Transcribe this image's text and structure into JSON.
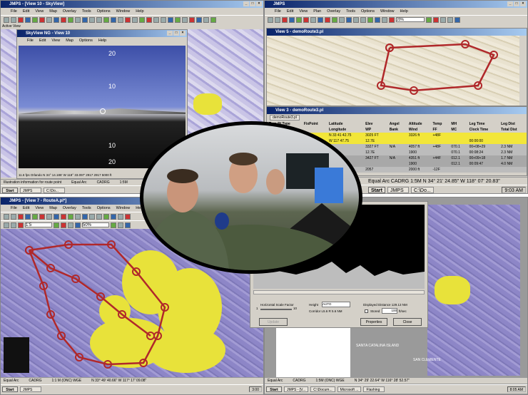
{
  "top_left": {
    "title": "JMPS - [View 10 - SkyView]",
    "menu": [
      "File",
      "Edit",
      "View",
      "Map",
      "Overlay",
      "Tools",
      "Options",
      "Window",
      "Help"
    ],
    "active_view_label": "Active View",
    "skyview": {
      "title": "SkyView NG - View 10",
      "menu": [
        "File",
        "Edit",
        "View",
        "Map",
        "Options",
        "Help"
      ],
      "pitch_labels": [
        "20",
        "10",
        "10",
        "20"
      ],
      "status": "11.6 fps  Orlando  N 34° 14.186'  W 118° 33.097'  2917  2917  5000 ft"
    },
    "status": "Illustration information for route point",
    "status_right": [
      "Equal Arc",
      "CADRG",
      "1:5M"
    ],
    "taskbar": {
      "start": "Start",
      "tasks": [
        "JMPS",
        "C:\\Do..."
      ]
    }
  },
  "top_right": {
    "title": "JMPS",
    "menu": [
      "File",
      "Edit",
      "View",
      "Plan",
      "Overlay",
      "Tools",
      "Options",
      "Window",
      "Help"
    ],
    "zoom_value": "20%",
    "map_view_title": "View 5 - demoRoute3.pl",
    "table_view_title": "View 3 - demoRoute3.pl",
    "table_tab": "demoRoute3.pl",
    "table_headers": [
      [
        "Turn Pt Type",
        "FixPoint",
        "Latitude",
        "Elev",
        "Angel",
        "Altitude",
        "Temp",
        "MH",
        "Leg Time",
        "Leg Dist"
      ],
      [
        "",
        "",
        "Longitude",
        "WP",
        "Bank",
        "Wind",
        "FF",
        "MC",
        "Clock Time",
        "Total Dist"
      ]
    ],
    "table_rows": [
      [
        "",
        "",
        "N 33 41 42.75",
        "3025 FT",
        "",
        "3326 ft",
        "+48F",
        "",
        "",
        ""
      ],
      [
        "",
        "",
        "W 117 47.75",
        "12.7E",
        "",
        "",
        "",
        "",
        "00:00:00",
        ""
      ],
      [
        "",
        "",
        "",
        "3327 FT",
        "N/A",
        "4057 ft",
        "+48F",
        "070.1",
        "00+08+29",
        "2.3 NM"
      ],
      [
        "",
        "",
        "",
        "12.7E",
        "",
        "1900",
        "",
        "070.1",
        "00:08:24",
        "2.3 NM"
      ],
      [
        "",
        "",
        "",
        "3427 FT",
        "N/A",
        "4351 ft",
        "+44F",
        "012.1",
        "00+09+18",
        "1.7 NM"
      ],
      [
        "",
        "",
        "",
        "",
        "",
        "1900",
        "",
        "012.1",
        "00:09:47",
        "4.0 NM"
      ],
      [
        "",
        "",
        "",
        "2057",
        "",
        "2000 ft",
        "-12F",
        "",
        "",
        ""
      ]
    ],
    "status": "Equal Arc  CADRG  1:5M  N 34° 21' 24.85\"  W 118° 07' 20.83\"",
    "taskbar": {
      "start": "Start",
      "tasks": [
        "JMPS",
        "C:\\Do..."
      ],
      "clock": "9:03 AM"
    }
  },
  "bottom_left": {
    "title": "JMPS - [View 7 - RouteA.pl*]",
    "menu": [
      "File",
      "Edit",
      "View",
      "Map",
      "Overlay",
      "Tools",
      "Options",
      "Window",
      "Help"
    ],
    "scale_value": "1:5",
    "zoom_value": "50%",
    "status": [
      "Equal Arc",
      "CADRG",
      "1:1 M (ONC) WGE",
      "N 33° 49' 40.66\"  W 117° 17' 09.08\""
    ],
    "taskbar": {
      "start": "Start",
      "tasks": [
        "JMPS"
      ],
      "clock": "3:00"
    }
  },
  "profile_dialog": {
    "horizontal_scale_label": "Horizontal Scale Factor",
    "scale_min": "1",
    "scale_max": "10",
    "height_label": "Height",
    "height_value": "AUTO",
    "corridor": "Corridor L5.6  R 5.6 NM",
    "displayed_distance": "Displayed Distance 129.13 NM",
    "stored_label": "Stored",
    "stored_value": "100",
    "stored_unit": "ft/sec",
    "update": "Update",
    "properties": "Properties",
    "close": "Close"
  },
  "bottom_right": {
    "status": [
      "Equal Arc",
      "CADRG",
      "1:5M (ONC) WGE",
      "N 34° 29' 22.64\"  W 116° 28' 52.57\""
    ],
    "map_labels": [
      "SANTA CATALINA ISLAND",
      "SAN CLEMENTE"
    ],
    "taskbar": {
      "start": "Start",
      "tasks": [
        "JMPS - [V...",
        "C:\\Docum...",
        "Microsoft ...",
        "Flashing"
      ],
      "clock": "8:05 AM"
    }
  },
  "colors": {
    "route": "#b0282a",
    "threat": "#e8e23a",
    "title_bar": "#0a246a",
    "map_purple": "#8d86c7",
    "highlight_row": "#f2e63a"
  }
}
